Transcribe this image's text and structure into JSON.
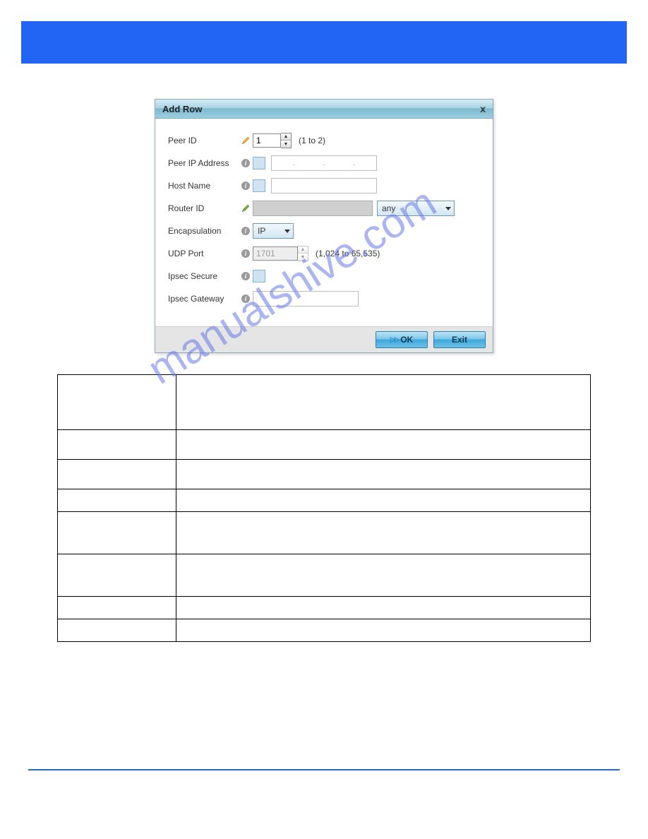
{
  "dialog": {
    "title": "Add Row",
    "fields": {
      "peer_id": {
        "label": "Peer ID",
        "value": "1",
        "hint": "(1 to 2)"
      },
      "peer_ip": {
        "label": "Peer IP Address",
        "dots": ". . ."
      },
      "host_name": {
        "label": "Host Name",
        "value": ""
      },
      "router_id": {
        "label": "Router ID",
        "select_value": "any"
      },
      "encapsulation": {
        "label": "Encapsulation",
        "value": "IP"
      },
      "udp_port": {
        "label": "UDP Port",
        "value": "1701",
        "hint": "(1,024 to 65,535)"
      },
      "ipsec_secure": {
        "label": "Ipsec Secure"
      },
      "ipsec_gateway": {
        "label": "Ipsec Gateway",
        "value": ""
      }
    },
    "buttons": {
      "ok": "OK",
      "exit": "Exit"
    }
  },
  "watermark": "manualshive.com",
  "table_rows": [
    {
      "h": 78
    },
    {
      "h": 42
    },
    {
      "h": 42
    },
    {
      "h": 32
    },
    {
      "h": 60
    },
    {
      "h": 60
    },
    {
      "h": 32
    },
    {
      "h": 32
    }
  ]
}
